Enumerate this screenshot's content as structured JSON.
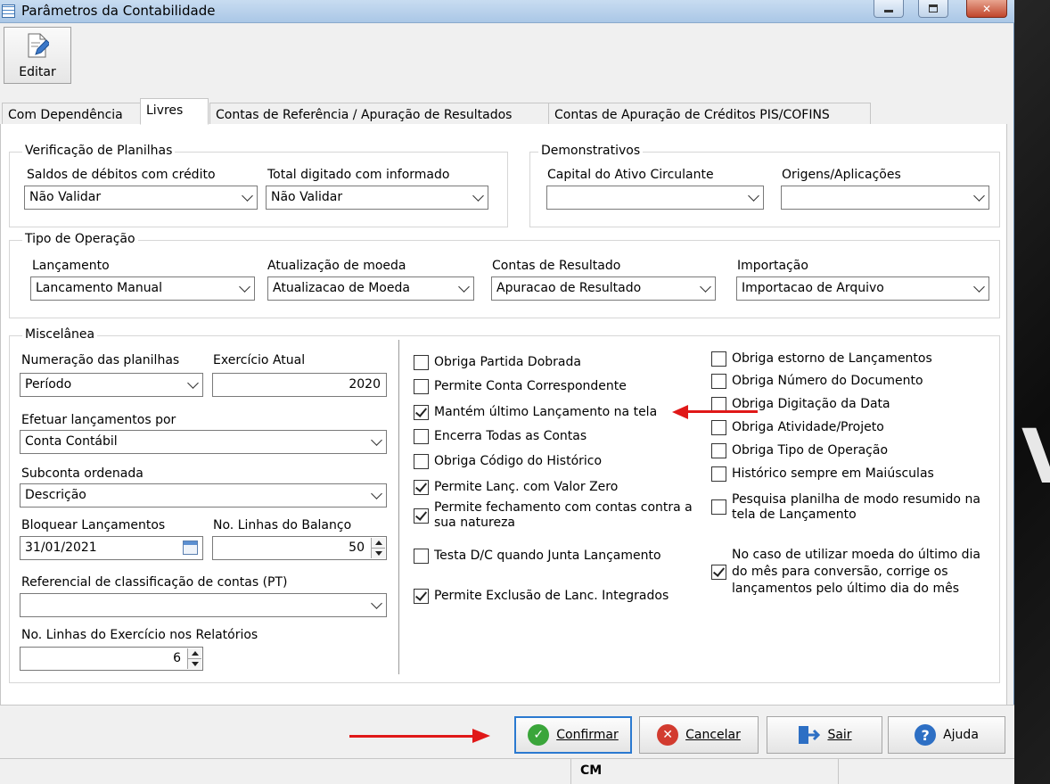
{
  "window": {
    "title": "Parâmetros da Contabilidade"
  },
  "toolbar": {
    "edit_label": "Editar"
  },
  "tabs": [
    {
      "label": "Com Dependência"
    },
    {
      "label": "Livres"
    },
    {
      "label": "Contas de Referência / Apuração de Resultados"
    },
    {
      "label": "Contas de Apuração de Créditos PIS/COFINS"
    }
  ],
  "verificacao": {
    "title": "Verificação de Planilhas",
    "saldos_label": "Saldos de débitos com crédito",
    "saldos_value": "Não Validar",
    "total_label": "Total digitado com informado",
    "total_value": "Não Validar"
  },
  "demonstrativos": {
    "title": "Demonstrativos",
    "capital_label": "Capital do Ativo Circulante",
    "capital_value": "",
    "origens_label": "Origens/Aplicações",
    "origens_value": ""
  },
  "tipo_operacao": {
    "title": "Tipo de Operação",
    "lancamento_label": "Lançamento",
    "lancamento_value": "Lancamento Manual",
    "atualizacao_label": "Atualização de moeda",
    "atualizacao_value": "Atualizacao de Moeda",
    "contas_label": "Contas de Resultado",
    "contas_value": "Apuracao de Resultado",
    "importacao_label": "Importação",
    "importacao_value": "Importacao de Arquivo"
  },
  "miscelanea": {
    "title": "Miscelânea",
    "numeracao_label": "Numeração das planilhas",
    "numeracao_value": "Período",
    "exercicio_label": "Exercício Atual",
    "exercicio_value": "2020",
    "efetuar_label": "Efetuar lançamentos por",
    "efetuar_value": "Conta Contábil",
    "subconta_label": "Subconta ordenada",
    "subconta_value": "Descrição",
    "bloquear_label": "Bloquear Lançamentos",
    "bloquear_value": "31/01/2021",
    "linhas_balanco_label": "No. Linhas do Balanço",
    "linhas_balanco_value": "50",
    "referencial_label": "Referencial de classificação de contas (PT)",
    "referencial_value": "",
    "linhas_exercicio_label": "No. Linhas do Exercício nos Relatórios",
    "linhas_exercicio_value": "6"
  },
  "checks_left": [
    {
      "label": "Obriga Partida Dobrada",
      "checked": false
    },
    {
      "label": "Permite Conta Correspondente",
      "checked": false
    },
    {
      "label": "Mantém último Lançamento na tela",
      "checked": true
    },
    {
      "label": "Encerra Todas as Contas",
      "checked": false
    },
    {
      "label": "Obriga Código do Histórico",
      "checked": false
    },
    {
      "label": "Permite Lanç. com Valor Zero",
      "checked": true
    },
    {
      "label_lines": [
        "Permite fechamento com contas contra a",
        "sua natureza"
      ],
      "checked": true
    },
    {
      "label": "Testa D/C quando Junta Lançamento",
      "checked": false
    },
    {
      "label": "Permite Exclusão de Lanc. Integrados",
      "checked": true
    }
  ],
  "checks_right": [
    {
      "label": "Obriga estorno de Lançamentos",
      "checked": false
    },
    {
      "label": "Obriga Número do Documento",
      "checked": false
    },
    {
      "label": "Obriga Digitação da Data",
      "checked": false
    },
    {
      "label": "Obriga Atividade/Projeto",
      "checked": false
    },
    {
      "label": "Obriga Tipo de Operação",
      "checked": false
    },
    {
      "label": "Histórico sempre em Maiúsculas",
      "checked": false
    },
    {
      "label_lines": [
        "Pesquisa planilha de modo resumido na",
        "tela de Lançamento"
      ],
      "checked": false
    },
    {
      "label_lines": [
        "No caso de utilizar moeda do último dia",
        "do mês para conversão, corrige os",
        "lançamentos pelo último dia do mês"
      ],
      "checked": true
    }
  ],
  "buttons": {
    "confirmar": "Confirmar",
    "cancelar": "Cancelar",
    "sair": "Sair",
    "ajuda": "Ajuda"
  },
  "statusbar": {
    "text": "CM"
  },
  "background": {
    "letter": "V"
  },
  "colors": {
    "accent": "#2a79d0",
    "annotation": "#e01818",
    "check_icon": "#3aa53a",
    "cancel_icon": "#d23b2f",
    "help_icon": "#2d6fc4"
  }
}
